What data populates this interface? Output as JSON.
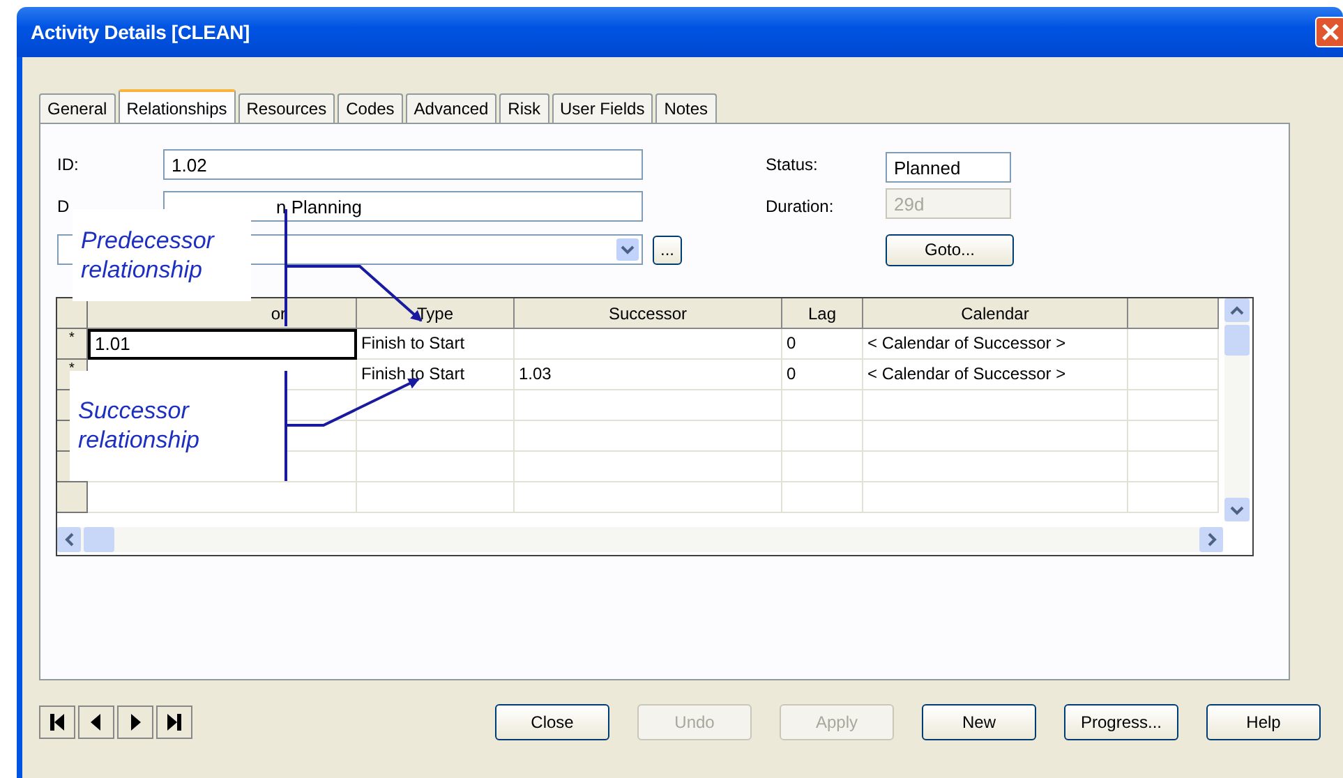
{
  "window": {
    "title": "Activity Details [CLEAN]"
  },
  "tabs": [
    {
      "label": "General",
      "selected": false
    },
    {
      "label": "Relationships",
      "selected": true
    },
    {
      "label": "Resources",
      "selected": false
    },
    {
      "label": "Codes",
      "selected": false
    },
    {
      "label": "Advanced",
      "selected": false
    },
    {
      "label": "Risk",
      "selected": false
    },
    {
      "label": "User Fields",
      "selected": false
    },
    {
      "label": "Notes",
      "selected": false
    }
  ],
  "fields": {
    "id": {
      "label": "ID:",
      "value": "1.02"
    },
    "description": {
      "label": "D",
      "value": "n Planning"
    },
    "status": {
      "label": "Status:",
      "value": "Planned"
    },
    "duration": {
      "label": "Duration:",
      "value": "29d",
      "disabled": true
    }
  },
  "browse_button": "...",
  "goto_button": "Goto...",
  "grid": {
    "columns": [
      "or",
      "Type",
      "Successor",
      "Lag",
      "Calendar"
    ],
    "rows": [
      {
        "marker": "*",
        "predecessor": "1.01",
        "focused": true,
        "type": "Finish to Start",
        "successor": "",
        "lag": "0",
        "calendar": "< Calendar of Successor >"
      },
      {
        "marker": "*",
        "predecessor": "",
        "focused": false,
        "type": "Finish to Start",
        "successor": "1.03",
        "lag": "0",
        "calendar": "< Calendar of Successor >"
      }
    ]
  },
  "annotations": [
    {
      "text": "Predecessor relationship"
    },
    {
      "text": "Successor relationship"
    }
  ],
  "buttons": [
    {
      "label": "Close",
      "disabled": false
    },
    {
      "label": "Undo",
      "disabled": true
    },
    {
      "label": "Apply",
      "disabled": true
    },
    {
      "label": "New",
      "disabled": false
    },
    {
      "label": "Progress...",
      "disabled": false
    },
    {
      "label": "Help",
      "disabled": false
    }
  ]
}
